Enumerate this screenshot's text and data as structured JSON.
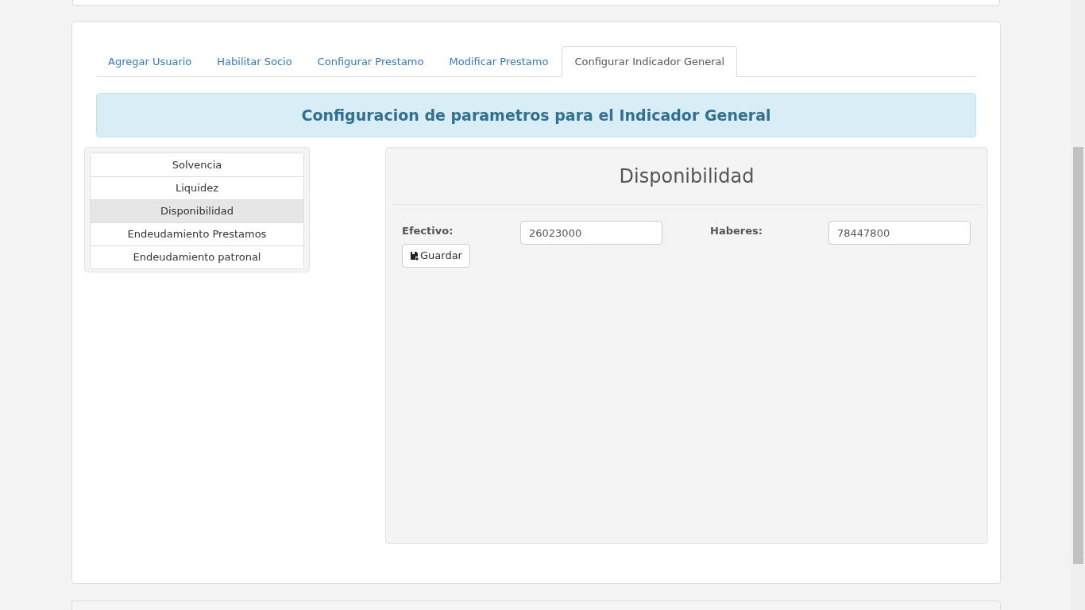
{
  "tabs": [
    {
      "label": "Agregar Usuario",
      "selected": false
    },
    {
      "label": "Habilitar Socio",
      "selected": false
    },
    {
      "label": "Configurar Prestamo",
      "selected": false
    },
    {
      "label": "Modificar Prestamo",
      "selected": false
    },
    {
      "label": "Configurar Indicador General",
      "selected": true
    }
  ],
  "banner": {
    "title": "Configuracion de parametros para el Indicador General"
  },
  "indicators": [
    {
      "label": "Solvencia",
      "selected": false
    },
    {
      "label": "Liquidez",
      "selected": false
    },
    {
      "label": "Disponibilidad",
      "selected": true
    },
    {
      "label": "Endeudamiento Prestamos",
      "selected": false
    },
    {
      "label": "Endeudamiento patronal",
      "selected": false
    }
  ],
  "panel": {
    "title": "Disponibilidad",
    "fields": [
      {
        "label": "Efectivo:",
        "value": "26023000"
      },
      {
        "label": "Haberes:",
        "value": "78447800"
      }
    ],
    "save_button": "Guardar"
  }
}
